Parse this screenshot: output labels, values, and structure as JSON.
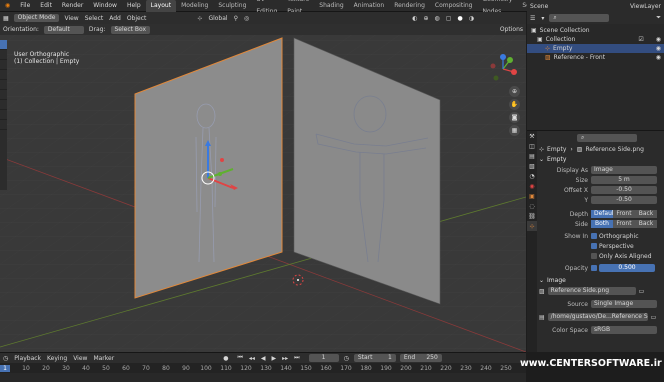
{
  "menubar": {
    "items": [
      "File",
      "Edit",
      "Render",
      "Window",
      "Help"
    ],
    "workspaces": [
      "Layout",
      "Modeling",
      "Sculpting",
      "UV Editing",
      "Texture Paint",
      "Shading",
      "Animation",
      "Rendering",
      "Compositing",
      "Geometry Nodes",
      "Scripting"
    ],
    "active_workspace": "Layout",
    "scene": "Scene",
    "view_layer": "ViewLayer"
  },
  "viewport": {
    "mode": "Object Mode",
    "menu": [
      "View",
      "Select",
      "Add",
      "Object"
    ],
    "transform": "Global",
    "orientation_label": "Orientation:",
    "orientation_value": "Default",
    "drag_label": "Drag:",
    "drag_value": "Select Box",
    "options": "Options",
    "info_line1": "User Orthographic",
    "info_line2": "(1) Collection | Empty"
  },
  "outliner": {
    "rows": [
      {
        "label": "Scene Collection",
        "indent": 0
      },
      {
        "label": "Collection",
        "indent": 1
      },
      {
        "label": "Empty",
        "indent": 2,
        "selected": true
      },
      {
        "label": "Reference - Front",
        "indent": 2
      }
    ]
  },
  "properties": {
    "breadcrumb_object": "Empty",
    "breadcrumb_data": "Reference Side.png",
    "panel_empty": "Empty",
    "display_as_label": "Display As",
    "display_as": "Image",
    "size_label": "Size",
    "size": "5 m",
    "offset_x_label": "Offset X",
    "offset_x": "-0.50",
    "offset_y_label": "Y",
    "offset_y": "-0.50",
    "depth_label": "Depth",
    "depth_options": [
      "Default",
      "Front",
      "Back"
    ],
    "side_label": "Side",
    "side_options": [
      "Both",
      "Front",
      "Back"
    ],
    "show_in_label": "Show In",
    "show_in": [
      "Orthographic",
      "Perspective",
      "Only Axis Aligned"
    ],
    "opacity_label": "Opacity",
    "opacity": "0.500",
    "panel_image": "Image",
    "image_name": "Reference Side.png",
    "source_label": "Source",
    "source": "Single Image",
    "filepath": "/home/gustavo/De...Reference Side.png",
    "color_space_label": "Color Space",
    "color_space": "sRGB"
  },
  "timeline": {
    "menu": [
      "Playback",
      "Keying",
      "View",
      "Marker"
    ],
    "current_frame": "1",
    "start_label": "Start",
    "start": "1",
    "end_label": "End",
    "end": "250",
    "ruler": [
      "1",
      "10",
      "20",
      "30",
      "40",
      "50",
      "60",
      "70",
      "80",
      "90",
      "100",
      "110",
      "120",
      "130",
      "140",
      "150",
      "160",
      "170",
      "180",
      "190",
      "200",
      "210",
      "220",
      "230",
      "240",
      "250"
    ]
  },
  "watermark": "www.CENTERSOFTWARE.ir",
  "colors": {
    "accent": "#4772b3",
    "selection_outline": "#e0883a",
    "background": "#393939"
  }
}
